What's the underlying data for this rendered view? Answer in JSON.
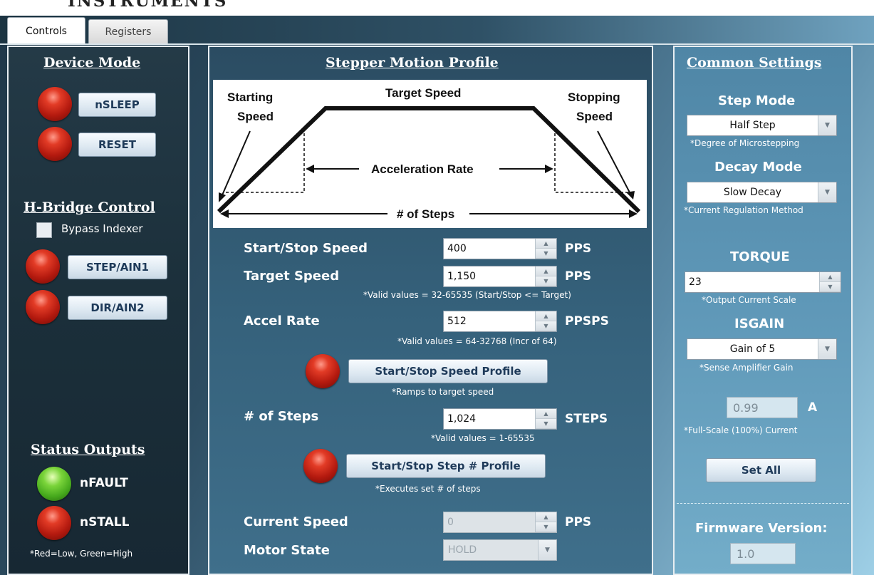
{
  "header": {
    "brand": "INSTRUMENTS"
  },
  "tabs": [
    {
      "label": "Controls",
      "active": true
    },
    {
      "label": "Registers",
      "active": false
    }
  ],
  "device_mode": {
    "title": "Device Mode",
    "nsleep": {
      "label": "nSLEEP",
      "led": "red"
    },
    "reset": {
      "label": "RESET",
      "led": "red"
    }
  },
  "hbridge": {
    "title": "H-Bridge Control",
    "bypass_label": "Bypass Indexer",
    "bypass_checked": false,
    "step": {
      "label": "STEP/AIN1",
      "led": "red"
    },
    "dir": {
      "label": "DIR/AIN2",
      "led": "red"
    }
  },
  "status_outputs": {
    "title": "Status Outputs",
    "nfault": {
      "label": "nFAULT",
      "led": "green"
    },
    "nstall": {
      "label": "nSTALL",
      "led": "red"
    },
    "legend": "*Red=Low, Green=High"
  },
  "motion_profile": {
    "title": "Stepper Motion Profile",
    "diagram": {
      "starting_speed_1": "Starting",
      "starting_speed_2": "Speed",
      "target_speed": "Target Speed",
      "stopping_speed_1": "Stopping",
      "stopping_speed_2": "Speed",
      "acceleration_rate": "Acceleration Rate",
      "num_steps": "# of Steps"
    },
    "start_stop_speed": {
      "label": "Start/Stop Speed",
      "value": "400",
      "unit": "PPS"
    },
    "target_speed": {
      "label": "Target Speed",
      "value": "1,150",
      "unit": "PPS"
    },
    "speed_note": "*Valid values = 32-65535 (Start/Stop <= Target)",
    "accel_rate": {
      "label": "Accel Rate",
      "value": "512",
      "unit": "PPSPS"
    },
    "accel_note": "*Valid values = 64-32768 (Incr of 64)",
    "speed_profile_button": "Start/Stop Speed Profile",
    "speed_profile_note": "*Ramps to target speed",
    "num_steps": {
      "label": "# of Steps",
      "value": "1,024",
      "unit": "STEPS"
    },
    "steps_note": "*Valid values = 1-65535",
    "step_profile_button": "Start/Stop Step # Profile",
    "step_profile_note": "*Executes set # of steps",
    "current_speed": {
      "label": "Current Speed",
      "value": "0",
      "unit": "PPS"
    },
    "motor_state": {
      "label": "Motor State",
      "value": "HOLD"
    }
  },
  "common_settings": {
    "title": "Common Settings",
    "step_mode": {
      "label": "Step Mode",
      "value": "Half Step",
      "note": "*Degree of Microstepping"
    },
    "decay_mode": {
      "label": "Decay Mode",
      "value": "Slow Decay",
      "note": "*Current Regulation Method"
    },
    "torque": {
      "label": "TORQUE",
      "value": "23",
      "note": "*Output Current Scale"
    },
    "isgain": {
      "label": "ISGAIN",
      "value": "Gain of 5",
      "note": "*Sense Amplifier Gain"
    },
    "full_scale": {
      "value": "0.99",
      "unit": "A",
      "note": "*Full-Scale (100%) Current"
    },
    "set_all_button": "Set All",
    "firmware": {
      "label": "Firmware Version:",
      "value": "1.0"
    }
  },
  "colors": {
    "led_red": "#c9230f",
    "led_green": "#5bbb2a",
    "button_text": "#1f3b5a"
  }
}
